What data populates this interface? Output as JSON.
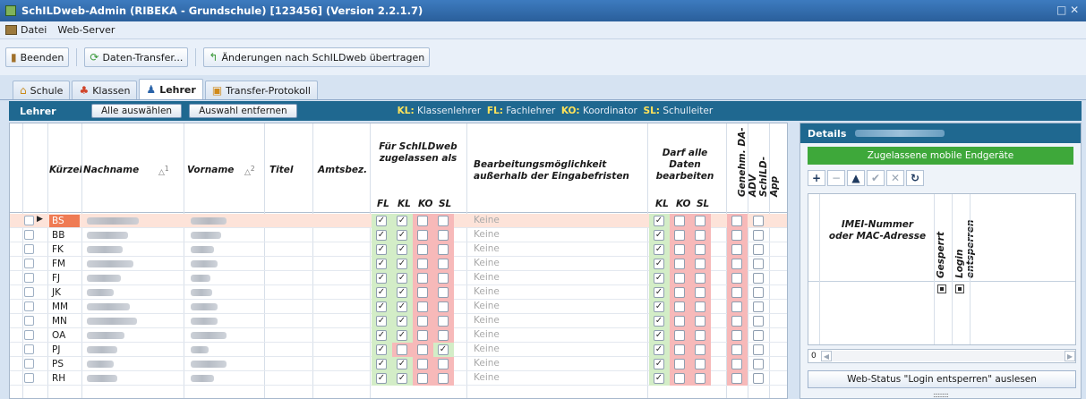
{
  "window": {
    "title": "SchILDweb-Admin  (RIBEKA - Grundschule) [123456]   (Version 2.2.1.7)",
    "controls": "□ ✕"
  },
  "menu": {
    "items": [
      "Datei",
      "Web-Server"
    ]
  },
  "toolbar": {
    "beenden": "Beenden",
    "transfer": "Daten-Transfer...",
    "upload": "Änderungen nach SchILDweb übertragen"
  },
  "tabs": [
    "Schule",
    "Klassen",
    "Lehrer",
    "Transfer-Protokoll"
  ],
  "lehrer": {
    "title": "Lehrer",
    "select_all": "Alle auswählen",
    "clear_sel": "Auswahl entfernen",
    "legend": [
      {
        "key": "KL:",
        "text": "Klassenlehrer"
      },
      {
        "key": "FL:",
        "text": "Fachlehrer"
      },
      {
        "key": "KO:",
        "text": "Koordinator"
      },
      {
        "key": "SL:",
        "text": "Schulleiter"
      }
    ]
  },
  "table": {
    "headers": {
      "kuerzel": "Kürzel",
      "nachname": "Nachname",
      "vorname": "Vorname",
      "titel": "Titel",
      "amtsbez": "Amtsbez.",
      "zugelassen": "Für SchILDweb zugelassen als",
      "bearbeitung": "Bearbeitungsmöglichkeit außerhalb der Eingabefristen",
      "darf": "Darf alle Daten bearbeiten",
      "genehm": "Genehm. DA-ADV",
      "app": "SchILD-App",
      "fl": "FL",
      "kl": "KL",
      "ko": "KO",
      "sl": "SL",
      "kl2": "KL",
      "ko2": "KO",
      "sl2": "SL",
      "sort_nachname": "1",
      "sort_vorname": "2"
    },
    "rows": [
      {
        "kuerzel": "BS",
        "bearbeitung": "Keine",
        "fl": true,
        "kl": true,
        "ko": false,
        "sl": false,
        "dkl": true,
        "dko": false,
        "dsl": false,
        "genehm": false,
        "selected": true
      },
      {
        "kuerzel": "BB",
        "bearbeitung": "Keine",
        "fl": true,
        "kl": true,
        "ko": false,
        "sl": false,
        "dkl": true,
        "dko": false,
        "dsl": false,
        "genehm": false
      },
      {
        "kuerzel": "FK",
        "bearbeitung": "Keine",
        "fl": true,
        "kl": true,
        "ko": false,
        "sl": false,
        "dkl": true,
        "dko": false,
        "dsl": false,
        "genehm": false
      },
      {
        "kuerzel": "FM",
        "bearbeitung": "Keine",
        "fl": true,
        "kl": true,
        "ko": false,
        "sl": false,
        "dkl": true,
        "dko": false,
        "dsl": false,
        "genehm": false
      },
      {
        "kuerzel": "FJ",
        "bearbeitung": "Keine",
        "fl": true,
        "kl": true,
        "ko": false,
        "sl": false,
        "dkl": true,
        "dko": false,
        "dsl": false,
        "genehm": false
      },
      {
        "kuerzel": "JK",
        "bearbeitung": "Keine",
        "fl": true,
        "kl": true,
        "ko": false,
        "sl": false,
        "dkl": true,
        "dko": false,
        "dsl": false,
        "genehm": false
      },
      {
        "kuerzel": "MM",
        "bearbeitung": "Keine",
        "fl": true,
        "kl": true,
        "ko": false,
        "sl": false,
        "dkl": true,
        "dko": false,
        "dsl": false,
        "genehm": false
      },
      {
        "kuerzel": "MN",
        "bearbeitung": "Keine",
        "fl": true,
        "kl": true,
        "ko": false,
        "sl": false,
        "dkl": true,
        "dko": false,
        "dsl": false,
        "genehm": false
      },
      {
        "kuerzel": "OA",
        "bearbeitung": "Keine",
        "fl": true,
        "kl": true,
        "ko": false,
        "sl": false,
        "dkl": true,
        "dko": false,
        "dsl": false,
        "genehm": false
      },
      {
        "kuerzel": "PJ",
        "bearbeitung": "Keine",
        "fl": true,
        "kl": false,
        "ko": false,
        "sl": true,
        "dkl": true,
        "dko": false,
        "dsl": false,
        "genehm": false
      },
      {
        "kuerzel": "PS",
        "bearbeitung": "Keine",
        "fl": true,
        "kl": true,
        "ko": false,
        "sl": false,
        "dkl": true,
        "dko": false,
        "dsl": false,
        "genehm": false
      },
      {
        "kuerzel": "RH",
        "bearbeitung": "Keine",
        "fl": true,
        "kl": true,
        "ko": false,
        "sl": false,
        "dkl": true,
        "dko": false,
        "dsl": false,
        "genehm": false
      }
    ]
  },
  "details": {
    "title": "Details",
    "green": "Zugelassene mobile Endgeräte",
    "tools": [
      "+",
      "−",
      "▲",
      "✔",
      "✕",
      "↻"
    ],
    "col_imei": "IMEI-Nummer oder MAC-Adresse",
    "col_gesperrt": "Gesperrt",
    "col_login": "Login entsperren",
    "scroll_value": "0",
    "button": "Web-Status \"Login entsperren\" auslesen",
    "grip": "::::::::::"
  },
  "colors": {
    "header_blue": "#1f6890",
    "selected_row": "#fde3d9",
    "selected_cell": "#ef7b54",
    "green_cell": "#d3edc7",
    "red_cell": "#f7b9b9",
    "green_bar": "#3ea83a"
  }
}
